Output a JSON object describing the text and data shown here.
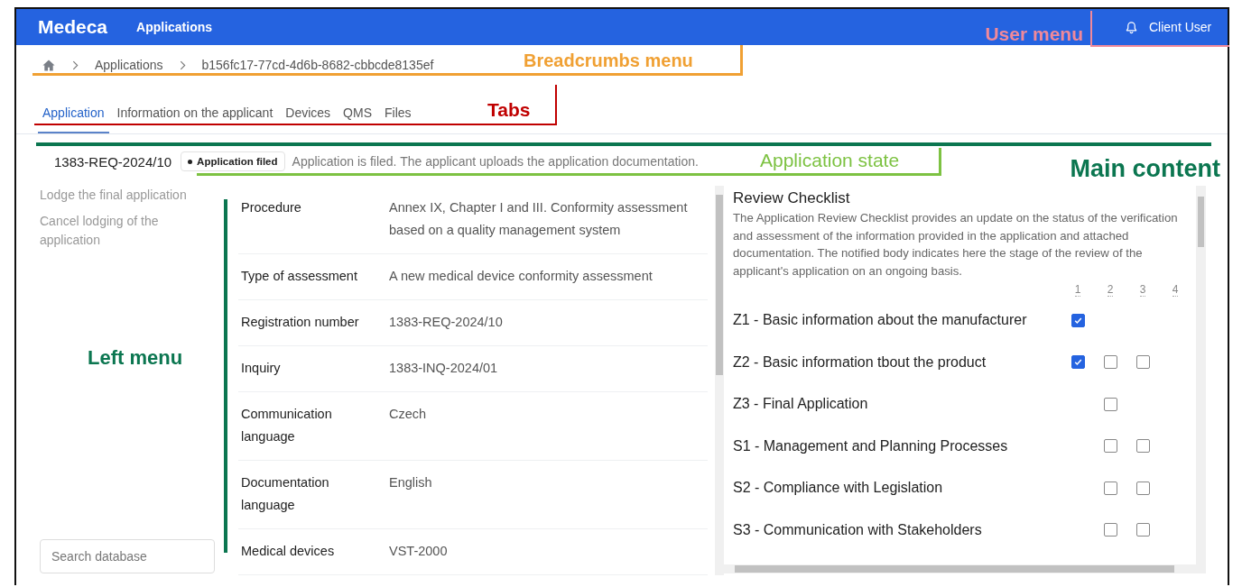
{
  "header": {
    "logo": "Medeca",
    "nav": "Applications",
    "user": "Client User",
    "annotation": {
      "label": "User menu",
      "color": "#f0899a"
    }
  },
  "breadcrumbs": {
    "items": [
      "Applications",
      "b156fc17-77cd-4d6b-8682-cbbcde8135ef"
    ],
    "annotation": {
      "label": "Breadcrumbs menu",
      "color": "#f0a033"
    }
  },
  "tabs": {
    "items": [
      {
        "label": "Application",
        "selected": true
      },
      {
        "label": "Information on the applicant",
        "selected": false
      },
      {
        "label": "Devices",
        "selected": false
      },
      {
        "label": "QMS",
        "selected": false
      },
      {
        "label": "Files",
        "selected": false
      }
    ],
    "annotation": {
      "label": "Tabs",
      "color": "#c00000"
    }
  },
  "main_annotation": {
    "label": "Main content",
    "color": "#0b7650"
  },
  "state": {
    "number": "1383-REQ-2024/10",
    "badge": "Application filed",
    "description": "Application is filed. The applicant uploads the application documentation.",
    "annotation": {
      "label": "Application state",
      "color": "#7dc242"
    }
  },
  "left_menu": {
    "links": [
      "Lodge the final application",
      "Cancel lodging of the application"
    ],
    "search": {
      "placeholder": "Search database"
    },
    "annotation": {
      "label": "Left menu",
      "color": "#0b7650"
    }
  },
  "details": [
    {
      "label": "Procedure",
      "value": "Annex IX, Chapter I and III. Conformity assessment based on a quality management system"
    },
    {
      "label": "Type of assessment",
      "value": "A new medical device conformity assessment"
    },
    {
      "label": "Registration number",
      "value": "1383-REQ-2024/10"
    },
    {
      "label": "Inquiry",
      "value": "1383-INQ-2024/01"
    },
    {
      "label": "Communication language",
      "value": "Czech"
    },
    {
      "label": "Documentation language",
      "value": "English"
    },
    {
      "label": "Medical devices",
      "value": "VST-2000"
    }
  ],
  "checklist": {
    "title": "Review Checklist",
    "description": "The Application Review Checklist provides an update on the status of the verification and assessment of the information provided in the application and attached documentation. The notified body indicates here the stage of the review of the applicant's application on an ongoing basis.",
    "columns": [
      "1",
      "2",
      "3",
      "4"
    ],
    "items": [
      {
        "label": "Z1 - Basic information about the manufacturer",
        "cells": [
          {
            "kind": "checkbox",
            "checked": true
          },
          {
            "kind": "empty"
          },
          {
            "kind": "empty"
          },
          {
            "kind": "empty"
          }
        ]
      },
      {
        "label": "Z2 - Basic information tbout the product",
        "cells": [
          {
            "kind": "checkbox",
            "checked": true
          },
          {
            "kind": "checkbox",
            "checked": false
          },
          {
            "kind": "checkbox",
            "checked": false
          },
          {
            "kind": "empty"
          }
        ]
      },
      {
        "label": "Z3 - Final Application",
        "cells": [
          {
            "kind": "empty"
          },
          {
            "kind": "checkbox",
            "checked": false
          },
          {
            "kind": "empty"
          },
          {
            "kind": "empty"
          }
        ]
      },
      {
        "label": "S1 - Management and Planning Processes",
        "cells": [
          {
            "kind": "empty"
          },
          {
            "kind": "checkbox",
            "checked": false
          },
          {
            "kind": "checkbox",
            "checked": false
          },
          {
            "kind": "empty"
          }
        ]
      },
      {
        "label": "S2 - Compliance with Legislation",
        "cells": [
          {
            "kind": "empty"
          },
          {
            "kind": "checkbox",
            "checked": false
          },
          {
            "kind": "checkbox",
            "checked": false
          },
          {
            "kind": "empty"
          }
        ]
      },
      {
        "label": "S3 - Communication with Stakeholders",
        "cells": [
          {
            "kind": "empty"
          },
          {
            "kind": "checkbox",
            "checked": false
          },
          {
            "kind": "checkbox",
            "checked": false
          },
          {
            "kind": "empty"
          }
        ]
      }
    ]
  }
}
